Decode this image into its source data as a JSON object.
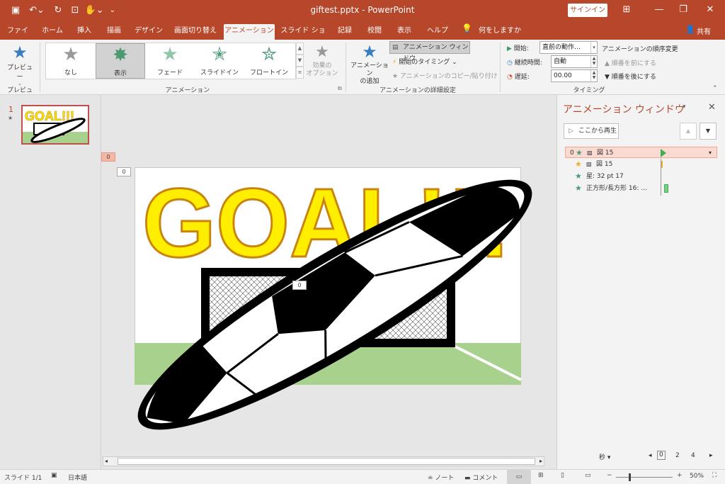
{
  "titlebar": {
    "doc_title": "giftest.pptx  -  PowerPoint",
    "signin": "サインイン"
  },
  "tabs": [
    {
      "label": "ファイル"
    },
    {
      "label": "ホーム"
    },
    {
      "label": "挿入"
    },
    {
      "label": "描画"
    },
    {
      "label": "デザイン"
    },
    {
      "label": "画面切り替え"
    },
    {
      "label": "アニメーション"
    },
    {
      "label": "スライド ショー"
    },
    {
      "label": "記録"
    },
    {
      "label": "校閲"
    },
    {
      "label": "表示"
    },
    {
      "label": "ヘルプ"
    }
  ],
  "tellme": "何をしますか",
  "share": "共有",
  "ribbon": {
    "preview_label": "プレビュー",
    "preview_group": "プレビュー",
    "gallery": [
      {
        "label": "なし"
      },
      {
        "label": "表示"
      },
      {
        "label": "フェード"
      },
      {
        "label": "スライドイン"
      },
      {
        "label": "フロートイン"
      }
    ],
    "effect_options": "効果の\nオプション",
    "animation_group": "アニメーション",
    "add_animation": "アニメーション\nの追加",
    "anim_pane_btn": "アニメーション ウィンドウ",
    "trigger": "開始のタイミング",
    "painter": "アニメーションのコピー/貼り付け",
    "advanced_group": "アニメーションの詳細設定",
    "start_label": "開始:",
    "start_value": "直前の動作…",
    "duration_label": "継続時間:",
    "duration_value": "自動",
    "delay_label": "遅延:",
    "delay_value": "00.00",
    "reorder_title": "アニメーションの順序変更",
    "move_earlier": "順番を前にする",
    "move_later": "順番を後にする",
    "timing_group": "タイミング"
  },
  "thumb": {
    "number": "1",
    "goal_text": "GOAL!!!"
  },
  "slide": {
    "goal_text": "GOAL!!!",
    "tag": "0"
  },
  "anim_pane": {
    "title": "アニメーション ウィンドウ",
    "play_from": "ここから再生",
    "items": [
      {
        "num": "0",
        "label": "図 15"
      },
      {
        "num": "",
        "label": "図 15"
      },
      {
        "num": "",
        "label": "星: 32 pt 17"
      },
      {
        "num": "",
        "label": "正方形/長方形 16: …"
      }
    ],
    "seconds": "秒",
    "timeline_ticks": [
      "0",
      "2",
      "4"
    ]
  },
  "status": {
    "slide_info": "スライド 1/1",
    "language": "日本語",
    "notes": "ノート",
    "comments": "コメント",
    "zoom": "50%"
  }
}
